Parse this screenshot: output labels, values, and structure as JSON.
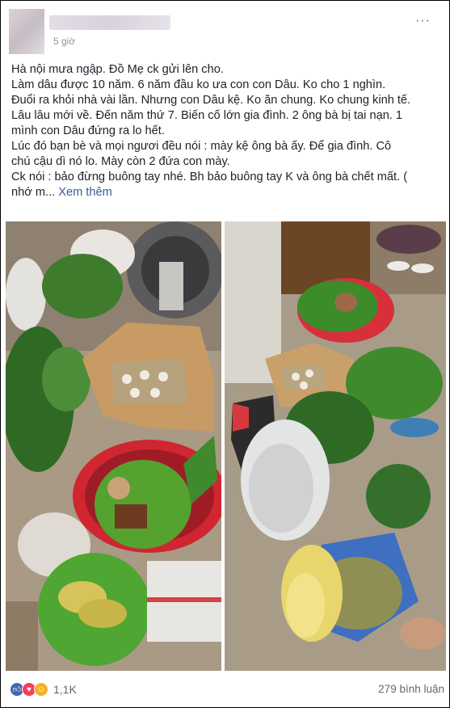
{
  "post": {
    "author_name": "",
    "timestamp": "5 giờ",
    "lines": [
      "Hà nội mưa ngập. Đồ Mẹ ck gửi lên cho.",
      "Làm dâu được 10 năm. 6 năm đầu ko ưa con con Dâu. Ko cho 1 nghìn.",
      "Đuổi ra khỏi nhà vài lần. Nhưng con Dâu kệ. Ko ăn chung. Ko chung kinh tế.",
      "Lâu lâu mới về. Đến năm thứ 7. Biến cố lớn gia đình. 2 ông bà bị tai nạn. 1",
      "mình con Dâu đứng ra lo hết.",
      "Lúc đó bạn bè và mọi ngươi đều nói : mày kệ ông bà ấy. Để gia đình. Cô",
      "chú cậu dì nó lo. Mày còn 2 đứa con mày.",
      "Ck nói : bảo đừng buông tay nhé. Bh bảo buông tay K và ông bà chết mất. (",
      "nhớ m..."
    ],
    "see_more": "Xem thêm"
  },
  "footer": {
    "reaction_count": "1,1K",
    "comment_count": "279 bình luận"
  },
  "icons": {
    "like": "thumbs-up-icon",
    "love": "heart-icon",
    "haha": "laughing-face-icon",
    "more": "more-options-icon"
  },
  "colors": {
    "link": "#385898",
    "muted": "#90949c",
    "like": "#4267b2",
    "love": "#f33e58",
    "haha": "#f7b125"
  }
}
